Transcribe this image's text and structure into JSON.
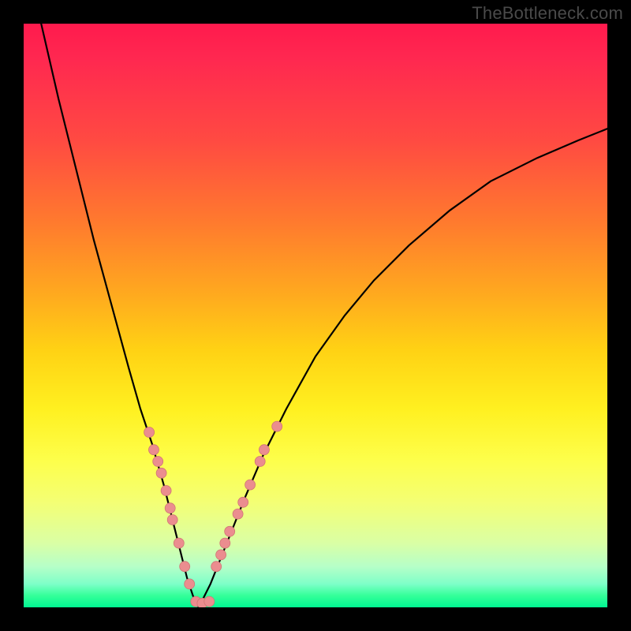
{
  "watermark": "TheBottleneck.com",
  "colors": {
    "dot_fill": "#eb8d8f",
    "dot_stroke": "#d07674",
    "curve_stroke": "#000000"
  },
  "chart_data": {
    "type": "line",
    "title": "",
    "xlabel": "",
    "ylabel": "",
    "xlim": [
      0,
      100
    ],
    "ylim": [
      0,
      100
    ],
    "vertex_x": 30,
    "series": [
      {
        "name": "left_curve",
        "x": [
          3,
          6,
          9,
          12,
          15,
          18,
          20,
          22,
          24,
          25,
          26,
          27,
          28,
          29,
          30
        ],
        "y": [
          100,
          87,
          75,
          63,
          52,
          41,
          34,
          28,
          21,
          17,
          13,
          9,
          5,
          2,
          0
        ]
      },
      {
        "name": "right_curve",
        "x": [
          30,
          32,
          34,
          36,
          38,
          41,
          45,
          50,
          55,
          60,
          66,
          73,
          80,
          88,
          95,
          100
        ],
        "y": [
          0,
          4,
          9,
          14,
          19,
          26,
          34,
          43,
          50,
          56,
          62,
          68,
          73,
          77,
          80,
          82
        ]
      }
    ],
    "left_dots": [
      {
        "x": 21.5,
        "y": 30
      },
      {
        "x": 22.3,
        "y": 27
      },
      {
        "x": 23.0,
        "y": 25
      },
      {
        "x": 23.6,
        "y": 23
      },
      {
        "x": 24.4,
        "y": 20
      },
      {
        "x": 25.1,
        "y": 17
      },
      {
        "x": 25.5,
        "y": 15
      },
      {
        "x": 26.6,
        "y": 11
      },
      {
        "x": 27.6,
        "y": 7
      },
      {
        "x": 28.4,
        "y": 4
      },
      {
        "x": 29.5,
        "y": 1
      },
      {
        "x": 30.6,
        "y": 0.7
      },
      {
        "x": 31.8,
        "y": 1
      }
    ],
    "right_dots": [
      {
        "x": 33.0,
        "y": 7
      },
      {
        "x": 33.8,
        "y": 9
      },
      {
        "x": 34.5,
        "y": 11
      },
      {
        "x": 35.3,
        "y": 13
      },
      {
        "x": 36.7,
        "y": 16
      },
      {
        "x": 37.6,
        "y": 18
      },
      {
        "x": 38.8,
        "y": 21
      },
      {
        "x": 40.5,
        "y": 25
      },
      {
        "x": 41.2,
        "y": 27
      },
      {
        "x": 43.4,
        "y": 31
      }
    ]
  }
}
